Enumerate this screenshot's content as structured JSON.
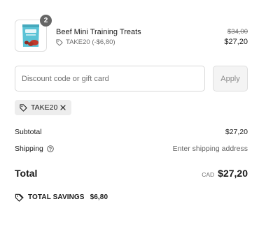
{
  "product": {
    "name": "Beef Mini Training Treats",
    "quantity": "2",
    "discount_label": "TAKE20 (-$6,80)",
    "original_price": "$34,00",
    "price": "$27,20",
    "thumbnail_icon": "treat-bag-image",
    "tag_icon": "tag-icon"
  },
  "discount": {
    "placeholder": "Discount code or gift card",
    "value": "",
    "apply_label": "Apply",
    "applied_code": "TAKE20",
    "remove_icon": "close-icon"
  },
  "summary": {
    "subtotal_label": "Subtotal",
    "subtotal_value": "$27,20",
    "shipping_label": "Shipping",
    "shipping_help_icon": "help-circle-icon",
    "shipping_value": "Enter shipping address",
    "total_label": "Total",
    "currency": "CAD",
    "total_value": "$27,20",
    "savings_label": "TOTAL SAVINGS",
    "savings_value": "$6,80",
    "savings_icon": "tags-icon"
  },
  "colors": {
    "text": "#1a1a1a",
    "muted": "#707070",
    "border": "#d9d9d9",
    "chip_bg": "#ededed",
    "badge_bg": "#666666",
    "product_bag": "#5cc3d6"
  }
}
